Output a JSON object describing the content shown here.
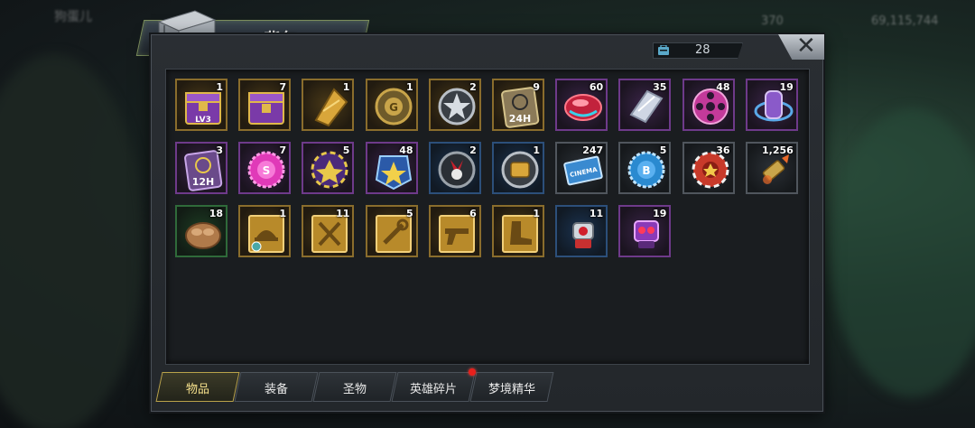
{
  "background": {
    "player_name": "狗蛋儿",
    "stat_1": "370",
    "stat_2": "69,115,744"
  },
  "window": {
    "title": "背包",
    "capacity_count": "28"
  },
  "items": [
    {
      "qty": "1",
      "icon": "purple-chest-lv3-icon",
      "rarity": "gold"
    },
    {
      "qty": "7",
      "icon": "purple-chest-icon",
      "rarity": "gold"
    },
    {
      "qty": "1",
      "icon": "gold-shard-icon",
      "rarity": "gold"
    },
    {
      "qty": "1",
      "icon": "gold-coin-token-icon",
      "rarity": "gold"
    },
    {
      "qty": "2",
      "icon": "silver-star-token-icon",
      "rarity": "gold"
    },
    {
      "qty": "9",
      "icon": "speedup-24h-icon",
      "rarity": "gold"
    },
    {
      "qty": "60",
      "icon": "red-gem-icon",
      "rarity": "purple"
    },
    {
      "qty": "35",
      "icon": "crystal-shard-icon",
      "rarity": "purple"
    },
    {
      "qty": "48",
      "icon": "film-reel-icon",
      "rarity": "purple"
    },
    {
      "qty": "19",
      "icon": "purple-capsule-icon",
      "rarity": "purple"
    },
    {
      "qty": "3",
      "icon": "speedup-12h-icon",
      "rarity": "purple"
    },
    {
      "qty": "7",
      "icon": "pink-bottle-cap-icon",
      "rarity": "purple"
    },
    {
      "qty": "5",
      "icon": "purple-poker-chip-icon",
      "rarity": "purple"
    },
    {
      "qty": "48",
      "icon": "star-badge-icon",
      "rarity": "purple"
    },
    {
      "qty": "2",
      "icon": "bunny-token-icon",
      "rarity": "blue"
    },
    {
      "qty": "1",
      "icon": "gold-token-blue-icon",
      "rarity": "blue"
    },
    {
      "qty": "247",
      "icon": "cinema-ticket-icon",
      "rarity": "grey"
    },
    {
      "qty": "5",
      "icon": "blue-bottle-cap-icon",
      "rarity": "grey"
    },
    {
      "qty": "36",
      "icon": "red-poker-chip-icon",
      "rarity": "grey"
    },
    {
      "qty": "1,256",
      "icon": "bullet-icon",
      "rarity": "grey"
    },
    {
      "qty": "18",
      "icon": "bread-icon",
      "rarity": "green"
    },
    {
      "qty": "1",
      "icon": "hat-blueprint-icon",
      "rarity": "gold"
    },
    {
      "qty": "11",
      "icon": "swords-blueprint-icon",
      "rarity": "gold"
    },
    {
      "qty": "5",
      "icon": "tools-blueprint-icon",
      "rarity": "gold"
    },
    {
      "qty": "6",
      "icon": "pistol-blueprint-icon",
      "rarity": "gold"
    },
    {
      "qty": "1",
      "icon": "boot-blueprint-icon",
      "rarity": "gold"
    },
    {
      "qty": "11",
      "icon": "red-robot-icon",
      "rarity": "blue"
    },
    {
      "qty": "19",
      "icon": "purple-robot-icon",
      "rarity": "purple"
    }
  ],
  "tabs": [
    {
      "label": "物品",
      "active": true
    },
    {
      "label": "装备",
      "active": false
    },
    {
      "label": "圣物",
      "active": false
    },
    {
      "label": "英雄碎片",
      "active": false,
      "notification": true
    },
    {
      "label": "梦境精华",
      "active": false
    }
  ]
}
